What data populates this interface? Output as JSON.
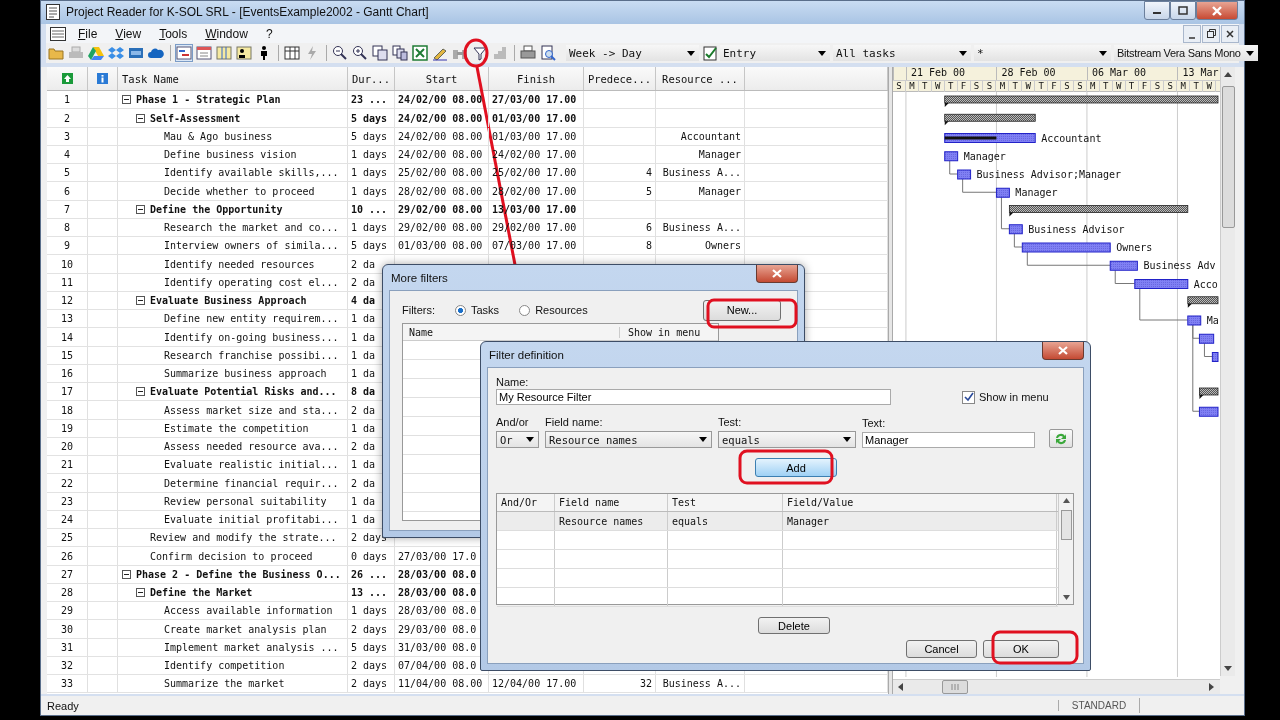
{
  "window": {
    "title": "Project Reader for K-SOL SRL - [EventsExample2002 - Gantt Chart]"
  },
  "menu": [
    "File",
    "View",
    "Tools",
    "Window",
    "?"
  ],
  "toolbar": {
    "view_buttons": [
      {
        "selected": true
      },
      {
        "selected": false
      },
      {
        "selected": false
      },
      {
        "selected": false
      },
      {
        "selected": false
      }
    ],
    "timescale": "Week -> Day",
    "table": "Entry",
    "filter": "All tasks",
    "group": "*",
    "font": "Bitstream Vera Sans Mono"
  },
  "table": {
    "columns": [
      "Task Name",
      "Dur...",
      "Start",
      "Finish",
      "Predece...",
      "Resource ..."
    ],
    "rows": [
      {
        "num": "1",
        "kind": "summary",
        "expanded": true,
        "name": "Phase 1 - Strategic Plan",
        "duration": "23 ...",
        "start": "24/02/00 08.00",
        "finish": "27/03/00 17.00",
        "children": [
          {
            "num": "2",
            "kind": "summary",
            "expanded": true,
            "name": "Self-Assessment",
            "duration": "5 days",
            "start": "24/02/00 08.00",
            "finish": "01/03/00 17.00",
            "children": [
              {
                "num": "3",
                "kind": "task",
                "name": "Mau & Ago business",
                "duration": "5 days",
                "start": "24/02/00 08.00",
                "finish": "01/03/00 17.00",
                "resource": "Accountant"
              },
              {
                "num": "4",
                "kind": "task",
                "name": "Define business vision",
                "duration": "1 days",
                "start": "24/02/00 08.00",
                "finish": "24/02/00 17.00",
                "resource": "Manager"
              },
              {
                "num": "5",
                "kind": "task",
                "name": "Identify available skills,...",
                "duration": "1 days",
                "start": "25/02/00 08.00",
                "finish": "25/02/00 17.00",
                "pred": "4",
                "resource": "Business A..."
              },
              {
                "num": "6",
                "kind": "task",
                "name": "Decide whether to proceed",
                "duration": "1 days",
                "start": "28/02/00 08.00",
                "finish": "28/02/00 17.00",
                "pred": "5",
                "resource": "Manager"
              }
            ]
          },
          {
            "num": "7",
            "kind": "summary",
            "expanded": true,
            "name": "Define the Opportunity",
            "duration": "10 ...",
            "start": "29/02/00 08.00",
            "finish": "13/03/00 17.00",
            "children": [
              {
                "num": "8",
                "kind": "task",
                "name": "Research the market and co...",
                "duration": "1 days",
                "start": "29/02/00 08.00",
                "finish": "29/02/00 17.00",
                "pred": "6",
                "resource": "Business A..."
              },
              {
                "num": "9",
                "kind": "task",
                "name": "Interview owners of simila...",
                "duration": "5 days",
                "start": "01/03/00 08.00",
                "finish": "07/03/00 17.00",
                "pred": "8",
                "resource": "Owners"
              },
              {
                "num": "10",
                "kind": "task",
                "name": "Identify needed resources",
                "duration": "2 da"
              },
              {
                "num": "11",
                "kind": "task",
                "name": "Identify operating cost el...",
                "duration": "2 da"
              }
            ]
          },
          {
            "num": "12",
            "kind": "summary",
            "expanded": true,
            "name": "Evaluate Business Approach",
            "duration": "4 da",
            "children": [
              {
                "num": "13",
                "kind": "task",
                "name": "Define new entity requirem...",
                "duration": "1 da"
              },
              {
                "num": "14",
                "kind": "task",
                "name": "Identify on-going business...",
                "duration": "1 da"
              },
              {
                "num": "15",
                "kind": "task",
                "name": "Research franchise possibi...",
                "duration": "1 da"
              },
              {
                "num": "16",
                "kind": "task",
                "name": "Summarize business approach",
                "duration": "1 da"
              }
            ]
          },
          {
            "num": "17",
            "kind": "summary",
            "expanded": true,
            "name": "Evaluate Potential Risks and...",
            "duration": "8 da",
            "children": [
              {
                "num": "18",
                "kind": "task",
                "name": "Assess market size and sta...",
                "duration": "2 da"
              },
              {
                "num": "19",
                "kind": "task",
                "name": "Estimate the competition",
                "duration": "1 da"
              },
              {
                "num": "20",
                "kind": "task",
                "name": "Assess needed resource ava...",
                "duration": "2 da"
              },
              {
                "num": "21",
                "kind": "task",
                "name": "Evaluate realistic initial...",
                "duration": "1 da"
              },
              {
                "num": "22",
                "kind": "task",
                "name": "Determine financial requir...",
                "duration": "2 da"
              },
              {
                "num": "23",
                "kind": "task",
                "name": "Review personal suitability",
                "duration": "1 da"
              },
              {
                "num": "24",
                "kind": "task",
                "name": "Evaluate initial profitabi...",
                "duration": "1 da"
              }
            ]
          },
          {
            "num": "25",
            "kind": "task",
            "name": "Review and modify the strate...",
            "duration": "2 days"
          },
          {
            "num": "26",
            "kind": "task",
            "name": "Confirm decision to proceed",
            "duration": "0 days",
            "start": "27/03/00 17.0"
          }
        ]
      },
      {
        "num": "27",
        "kind": "summary",
        "expanded": true,
        "name": "Phase 2 - Define the Business O...",
        "duration": "26 ...",
        "start": "28/03/00 08.0",
        "children": [
          {
            "num": "28",
            "kind": "summary",
            "expanded": true,
            "name": "Define the Market",
            "duration": "13 ...",
            "start": "28/03/00 08.0",
            "children": [
              {
                "num": "29",
                "kind": "task",
                "name": "Access available information",
                "duration": "1 days",
                "start": "28/03/00 08.0"
              },
              {
                "num": "30",
                "kind": "task",
                "name": "Create market analysis plan",
                "duration": "2 days",
                "start": "29/03/00 08.0"
              },
              {
                "num": "31",
                "kind": "task",
                "name": "Implement market analysis ...",
                "duration": "5 days",
                "start": "31/03/00 08.0"
              },
              {
                "num": "32",
                "kind": "task",
                "name": "Identify competition",
                "duration": "2 days",
                "start": "07/04/00 08.0"
              },
              {
                "num": "33",
                "kind": "task",
                "name": "Summarize the market",
                "duration": "2 days",
                "start": "11/04/00 08.00",
                "finish": "12/04/00 17.00",
                "pred": "32",
                "resource": "Business A..."
              }
            ]
          }
        ]
      }
    ]
  },
  "gantt": {
    "weeks": [
      "21 Feb 00",
      "28 Feb 00",
      "06 Mar 00",
      "13 Mar"
    ],
    "days": [
      "S",
      "M",
      "T",
      "W",
      "T",
      "F",
      "S",
      "S",
      "M",
      "T",
      "W",
      "T",
      "F",
      "S",
      "S",
      "M",
      "T",
      "W",
      "T",
      "F",
      "S",
      "S",
      "M",
      "T",
      "W"
    ],
    "bars": [
      {
        "kind": "summary"
      },
      {
        "kind": "summary"
      },
      {
        "kind": "task",
        "label": "Accountant"
      },
      {
        "kind": "task",
        "label": "Manager"
      },
      {
        "kind": "task",
        "label": "Business Advisor;Manager"
      },
      {
        "kind": "task",
        "label": "Manager"
      },
      {
        "kind": "summary"
      },
      {
        "kind": "task",
        "label": "Business Advisor"
      },
      {
        "kind": "task",
        "label": "Owners"
      },
      {
        "kind": "task",
        "label": "Business Adv"
      },
      {
        "kind": "task",
        "label": "Acco"
      },
      {
        "kind": "summary"
      },
      {
        "kind": "task",
        "label": "Ma"
      },
      {
        "kind": "task"
      },
      {
        "kind": "task"
      },
      {
        "kind": "summary"
      },
      {
        "kind": "task"
      }
    ]
  },
  "more_filters": {
    "title": "More filters",
    "filters_label": "Filters:",
    "options": [
      {
        "label": "Tasks",
        "selected": true
      },
      {
        "label": "Resources",
        "selected": false
      }
    ],
    "columns": [
      "Name",
      "Show in menu"
    ],
    "new_button": "New..."
  },
  "filter_definition": {
    "title": "Filter definition",
    "name_label": "Name:",
    "name": "My Resource Filter",
    "show_in_menu": {
      "label": "Show in menu",
      "checked": true
    },
    "andor_label": "And/or",
    "andor": "Or",
    "field_label": "Field name:",
    "field": "Resource names",
    "test_label": "Test:",
    "test": "equals",
    "text_label": "Text:",
    "text": "Manager",
    "add_button": "Add",
    "grid": {
      "columns": [
        "And/Or",
        "Field name",
        "Test",
        "Field/Value"
      ],
      "rows": [
        {
          "field": "Resource names",
          "test": "equals",
          "value": "Manager"
        }
      ]
    },
    "delete_button": "Delete",
    "cancel_button": "Cancel",
    "ok_button": "OK"
  },
  "status_bar": {
    "text": "Ready",
    "mode": "STANDARD"
  }
}
